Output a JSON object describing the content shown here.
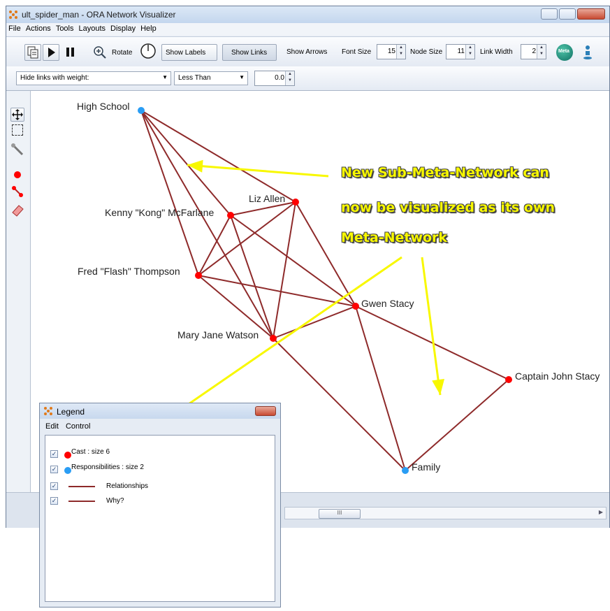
{
  "window": {
    "title": "ult_spider_man - ORA Network Visualizer"
  },
  "menubar": [
    "File",
    "Actions",
    "Tools",
    "Layouts",
    "Display",
    "Help"
  ],
  "toolbar": {
    "rotate_label": "Rotate",
    "show_labels": "Show Labels",
    "show_links": "Show Links",
    "show_arrows": "Show Arrows",
    "font_size_label": "Font Size",
    "font_size_value": "15",
    "node_size_label": "Node Size",
    "node_size_value": "11",
    "link_width_label": "Link Width",
    "link_width_value": "2",
    "meta_label": "Meta"
  },
  "filterbar": {
    "hide_links_label": "Hide links with weight:",
    "comparison": "Less Than",
    "threshold": "0.0"
  },
  "graph": {
    "nodes": {
      "high_school": "High School",
      "liz_allen": "Liz Allen",
      "kenny": "Kenny \"Kong\" McFarlane",
      "flash": "Fred \"Flash\" Thompson",
      "gwen": "Gwen Stacy",
      "mary_jane": "Mary Jane Watson",
      "captain": "Captain John Stacy",
      "family": "Family"
    },
    "colors": {
      "cast": "#ff0000",
      "responsibilities": "#2a9df4",
      "link": "#8e2a2a"
    }
  },
  "annotation": {
    "line1": "New Sub-Meta-Network can",
    "line2": "now be visualized as its own",
    "line3": "Meta-Network",
    "color": "#f8f800"
  },
  "scrollbar": {
    "thumb_text": "III"
  },
  "legend": {
    "title": "Legend",
    "menu": [
      "Edit",
      "Control"
    ],
    "items": [
      {
        "label": "Cast : size 6",
        "kind": "node",
        "color": "#ff0000"
      },
      {
        "label": "Responsibilities : size 2",
        "kind": "node",
        "color": "#2a9df4"
      },
      {
        "label": "Relationships",
        "kind": "link",
        "color": "#8e2a2a"
      },
      {
        "label": "Why?",
        "kind": "link",
        "color": "#8e2a2a"
      }
    ]
  }
}
